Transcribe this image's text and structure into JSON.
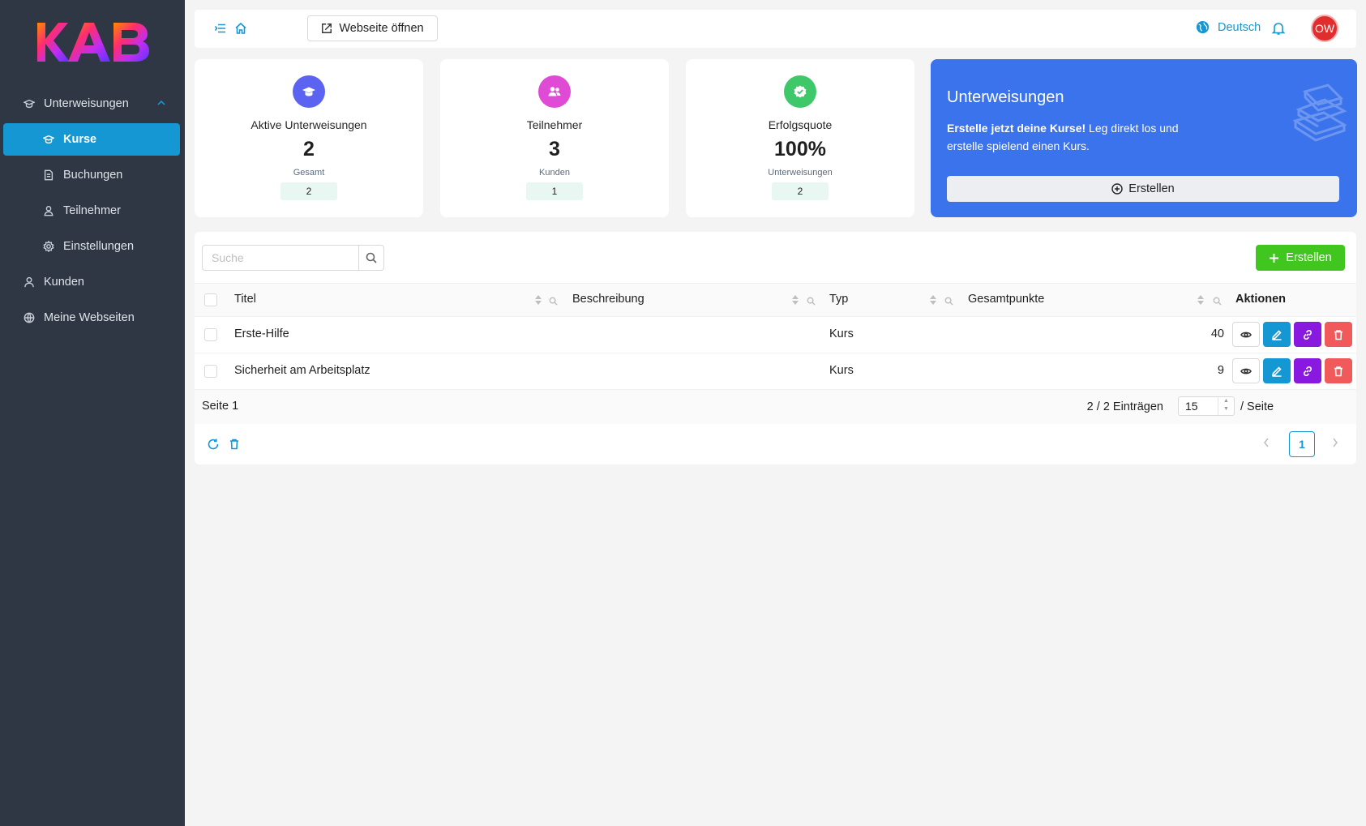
{
  "brand": {
    "logo_text": "KAB"
  },
  "sidebar": {
    "items": [
      {
        "label": "Unterweisungen"
      },
      {
        "label": "Kurse"
      },
      {
        "label": "Buchungen"
      },
      {
        "label": "Teilnehmer"
      },
      {
        "label": "Einstellungen"
      },
      {
        "label": "Kunden"
      },
      {
        "label": "Meine Webseiten"
      }
    ]
  },
  "topbar": {
    "open_site_label": "Webseite öffnen",
    "language": "Deutsch",
    "avatar_initials": "OW"
  },
  "stats": [
    {
      "label": "Aktive Unterweisungen",
      "value": "2",
      "sub": "Gesamt",
      "badge": "2",
      "color": "#5b63f0"
    },
    {
      "label": "Teilnehmer",
      "value": "3",
      "sub": "Kunden",
      "badge": "1",
      "color": "#e04bd6"
    },
    {
      "label": "Erfolgsquote",
      "value": "100%",
      "sub": "Unterweisungen",
      "badge": "2",
      "color": "#3fc86a"
    }
  ],
  "promo": {
    "title": "Unterweisungen",
    "text_bold": "Erstelle jetzt deine Kurse!",
    "text_rest": " Leg direkt los und erstelle spielend einen Kurs.",
    "button_label": "Erstellen"
  },
  "table": {
    "search_placeholder": "Suche",
    "create_label": "Erstellen",
    "columns": [
      "Titel",
      "Beschreibung",
      "Typ",
      "Gesamtpunkte",
      "Aktionen"
    ],
    "rows": [
      {
        "title": "Erste-Hilfe",
        "description": "",
        "type": "Kurs",
        "points": "40"
      },
      {
        "title": "Sicherheit am Arbeitsplatz",
        "description": "",
        "type": "Kurs",
        "points": "9"
      }
    ],
    "page_label": "Seite 1",
    "entries_label": "2 / 2 Einträgen",
    "page_size": "15",
    "per_page_label": "/ Seite",
    "current_page": "1"
  },
  "colors": {
    "accent": "#1597d3",
    "sidebar_bg": "#2f3744",
    "create_green": "#41c51f",
    "promo_blue": "#3b73ec"
  }
}
